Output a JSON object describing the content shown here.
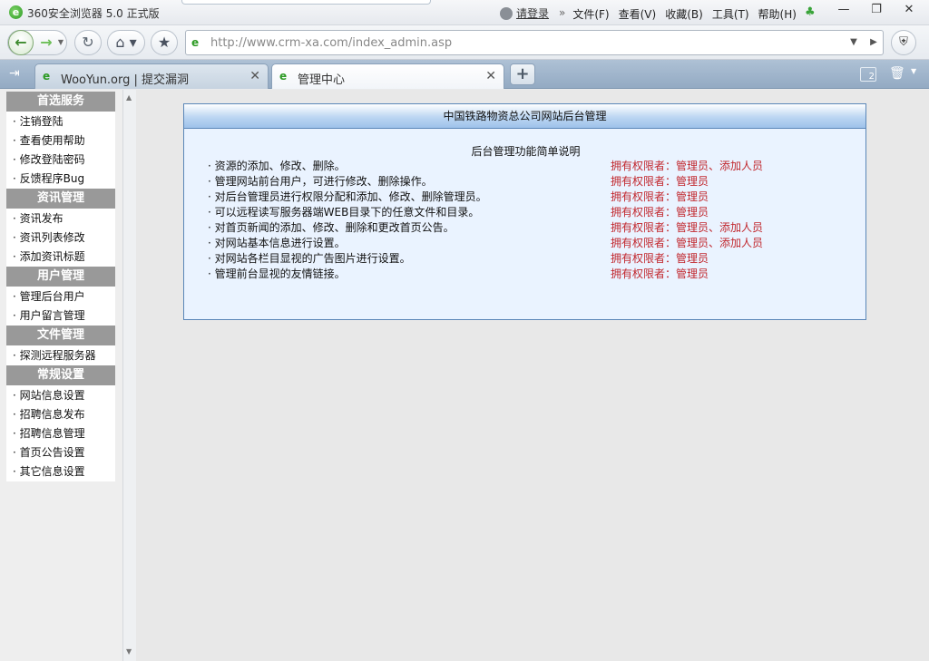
{
  "browser": {
    "title": "360安全浏览器 5.0 正式版",
    "login_label": "请登录",
    "menu": [
      "文件(F)",
      "查看(V)",
      "收藏(B)",
      "工具(T)",
      "帮助(H)"
    ],
    "url": "http://www.crm-xa.com/index_admin.asp",
    "tab_count": "2"
  },
  "tabs": [
    {
      "label": "WooYun.org | 提交漏洞",
      "active": false
    },
    {
      "label": "管理中心",
      "active": true
    }
  ],
  "sidebar": {
    "sections": [
      {
        "title": "首选服务",
        "items": [
          "注销登陆",
          "查看使用帮助",
          "修改登陆密码",
          "反馈程序Bug"
        ]
      },
      {
        "title": "资讯管理",
        "items": [
          "资讯发布",
          "资讯列表修改",
          "添加资讯标题"
        ]
      },
      {
        "title": "用户管理",
        "items": [
          "管理后台用户",
          "用户留言管理"
        ]
      },
      {
        "title": "文件管理",
        "items": [
          "探测远程服务器"
        ]
      },
      {
        "title": "常规设置",
        "items": [
          "网站信息设置",
          "招聘信息发布",
          "招聘信息管理",
          "首页公告设置",
          "其它信息设置"
        ]
      }
    ]
  },
  "panel": {
    "title": "中国铁路物资总公司网站后台管理",
    "subtitle": "后台管理功能简单说明",
    "rows": [
      {
        "desc": "资源的添加、修改、删除。",
        "perm": "拥有权限者：管理员、添加人员"
      },
      {
        "desc": "管理网站前台用户，可进行修改、删除操作。",
        "perm": "拥有权限者：管理员"
      },
      {
        "desc": "对后台管理员进行权限分配和添加、修改、删除管理员。",
        "perm": "拥有权限者：管理员"
      },
      {
        "desc": "可以远程读写服务器端WEB目录下的任意文件和目录。",
        "perm": "拥有权限者：管理员"
      },
      {
        "desc": "对首页新闻的添加、修改、删除和更改首页公告。",
        "perm": "拥有权限者：管理员、添加人员"
      },
      {
        "desc": "对网站基本信息进行设置。",
        "perm": "拥有权限者：管理员、添加人员"
      },
      {
        "desc": "对网站各栏目显视的广告图片进行设置。",
        "perm": "拥有权限者：管理员"
      },
      {
        "desc": "管理前台显视的友情链接。",
        "perm": "拥有权限者：管理员"
      }
    ]
  }
}
